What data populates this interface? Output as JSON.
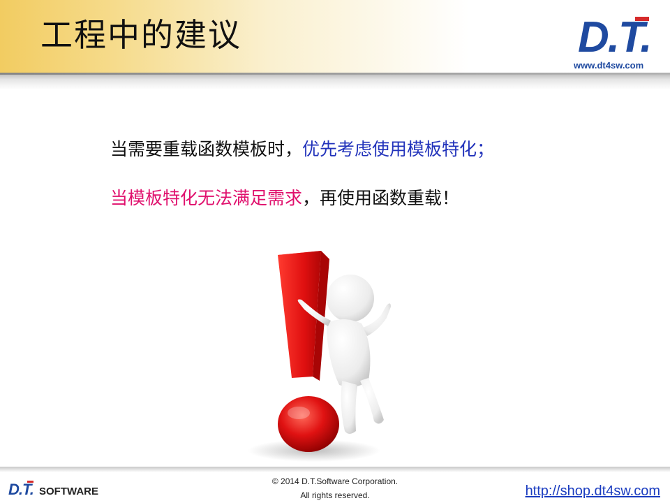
{
  "header": {
    "title": "工程中的建议",
    "logo_text": "D.T.",
    "logo_url": "www.dt4sw.com"
  },
  "content": {
    "line1": {
      "part1": "当需要重载函数模板时，",
      "part2": "优先考虑使用模板特化",
      "part3": "；"
    },
    "line2": {
      "part1": "当模板特化无法满足需求",
      "part2": "，再使用函数重载！"
    }
  },
  "footer": {
    "logo_text": "D.T.",
    "logo_sub": "SOFTWARE",
    "copyright_line1": "© 2014 D.T.Software Corporation.",
    "copyright_line2": "All rights reserved.",
    "shop_url": "http://shop.dt4sw.com"
  },
  "colors": {
    "accent_blue": "#2233bb",
    "accent_pink": "#e0106d",
    "logo_blue": "#1f4aa0",
    "logo_red": "#d62b2b"
  },
  "illustration": {
    "icon": "exclamation-figure-icon"
  }
}
